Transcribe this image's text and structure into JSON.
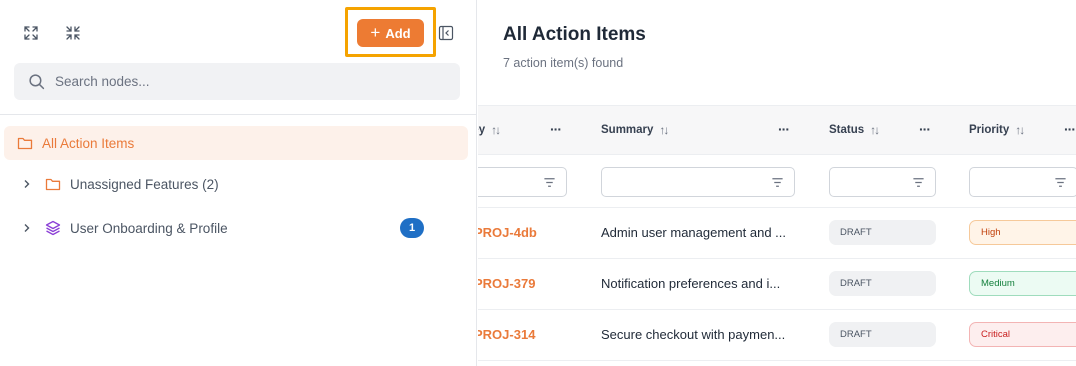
{
  "sidebar": {
    "add_label": "Add",
    "search_placeholder": "Search nodes...",
    "tree": [
      {
        "label": "All Action Items",
        "icon": "folder-icon",
        "active": true
      },
      {
        "label": "Unassigned Features (2)",
        "icon": "folder-icon"
      },
      {
        "label": "User Onboarding & Profile",
        "icon": "layers-icon",
        "count": "1"
      }
    ]
  },
  "main": {
    "title": "All Action Items",
    "subtitle": "7 action item(s) found",
    "columns": {
      "key": "Key",
      "summary": "Summary",
      "status": "Status",
      "priority": "Priority"
    },
    "rows": [
      {
        "key": "PROJ-4db",
        "summary": "Admin user management and ...",
        "status": "DRAFT",
        "priority": "High"
      },
      {
        "key": "PROJ-379",
        "summary": "Notification preferences and i...",
        "status": "DRAFT",
        "priority": "Medium"
      },
      {
        "key": "PROJ-314",
        "summary": "Secure checkout with paymen...",
        "status": "DRAFT",
        "priority": "Critical"
      }
    ]
  },
  "colors": {
    "accent": "#ed7b33",
    "highlight": "#f5a300",
    "badge": "#1f6fc5",
    "high_bg": "#fff4e8",
    "high_border": "#f6c99a",
    "high_text": "#c2410c",
    "medium_bg": "#ecfbf3",
    "medium_border": "#9fdcbd",
    "medium_text": "#15803d",
    "critical_bg": "#fdeeee",
    "critical_border": "#f3b4b4",
    "critical_text": "#c81e1e"
  }
}
